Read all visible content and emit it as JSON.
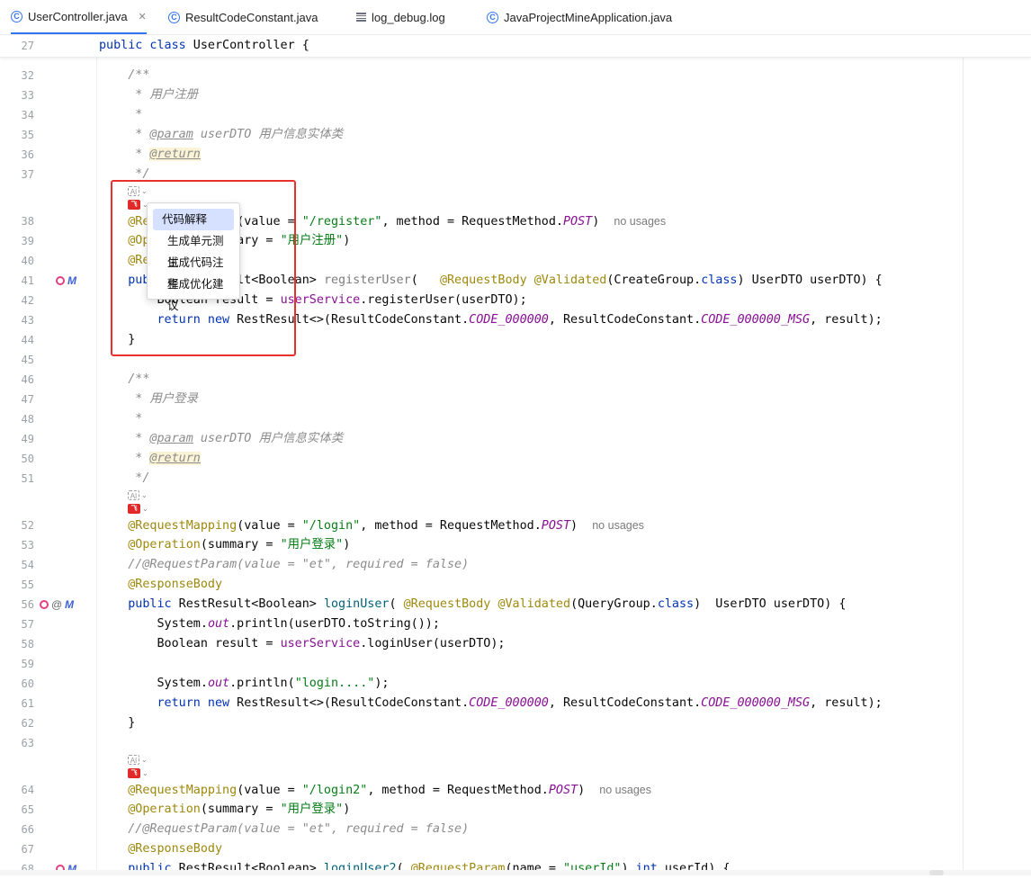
{
  "tabs": [
    {
      "label": "UserController.java",
      "icon": "java-class-icon",
      "active": true
    },
    {
      "label": "ResultCodeConstant.java",
      "icon": "java-class-icon"
    },
    {
      "label": "log_debug.log",
      "icon": "log-file-icon"
    },
    {
      "label": "JavaProjectMineApplication.java",
      "icon": "spring-boot-class-icon"
    }
  ],
  "sticky": {
    "line": "27",
    "code_kw": "public class",
    "code_rest": " UserController {"
  },
  "popup": {
    "items": [
      "代码解释",
      "生成单元测试",
      "生成代码注释",
      "生成优化建议"
    ],
    "selected": "代码解释"
  },
  "ai_badge": {
    "gray": "AI",
    "red": "飞"
  },
  "hints": {
    "no_usages": "no usages"
  },
  "lines": {
    "32": "32",
    "33": "33",
    "34": "34",
    "35": "35",
    "36": "36",
    "37": "37",
    "38": "38",
    "39": "39",
    "40": "40",
    "41": "41",
    "42": "42",
    "43": "43",
    "44": "44",
    "45": "45",
    "46": "46",
    "47": "47",
    "48": "48",
    "49": "49",
    "50": "50",
    "51": "51",
    "52": "52",
    "53": "53",
    "54": "54",
    "55": "55",
    "56": "56",
    "57": "57",
    "58": "58",
    "59": "59",
    "60": "60",
    "61": "61",
    "62": "62",
    "63": "63",
    "64": "64",
    "65": "65",
    "66": "66",
    "67": "67",
    "68": "68"
  },
  "doc": {
    "open": "/**",
    "register_title": " * 用户注册",
    "star": " *",
    "param_tag": "@param",
    "param_name": " userDTO ",
    "param_desc": "用户信息实体类",
    "return_tag": "@return",
    "close": " */",
    "login_title": " * 用户登录"
  },
  "code": {
    "l38_a": "@RequestMapping",
    "l38_b": "(value = ",
    "l38_c": "\"/register\"",
    "l38_d": ", method = RequestMethod.",
    "l38_e": "POST",
    "l38_f": ")",
    "l39_a": "@Operation",
    "l39_b": "(summary = ",
    "l39_c": "\"用户注册\"",
    "l39_d": ")",
    "l40_a": "@ResponseBody",
    "l41_a": "public",
    "l41_b": " RestResult<Boolean> ",
    "l41_c": "registerUser",
    "l41_d": "(   ",
    "l41_e": "@RequestBody",
    "l41_f": " ",
    "l41_g": "@Validated",
    "l41_h": "(CreateGroup.",
    "l41_i": "class",
    "l41_j": ") UserDTO userDTO) {",
    "l42_a": "    Boolean result = ",
    "l42_b": "userService",
    "l42_c": ".registerUser(userDTO);",
    "ret_a": "return new",
    "ret_b": " RestResult<>(ResultCodeConstant.",
    "ret_c": "CODE_000000",
    "ret_d": ", ResultCodeConstant.",
    "ret_e": "CODE_000000_MSG",
    "ret_f": ", result);",
    "brace": "}",
    "l52_c": "\"/login\"",
    "l53_c": "\"用户登录\"",
    "l54": "//@RequestParam(value = \"et\", required = false)",
    "l56_c": "loginUser",
    "l56_d": "( ",
    "l56_h": "(QueryGroup.",
    "l56_j": ")  UserDTO userDTO) {",
    "l57_a": "System.",
    "l57_b": "out",
    "l57_c": ".println(userDTO.toString());",
    "l58_c": ".loginUser(userDTO);",
    "l60_c": ".println(",
    "l60_d": "\"login....\"",
    "l60_e": ");",
    "l64_c": "\"/login2\"",
    "l65_c": "\"用户登录\"",
    "l68_c": "loginUser2",
    "l68_d": "( ",
    "l68_e": "@RequestParam",
    "l68_f": "(name = ",
    "l68_g": "\"userId\"",
    "l68_h": ") ",
    "l68_i": "int",
    "l68_j": " userId) {"
  }
}
